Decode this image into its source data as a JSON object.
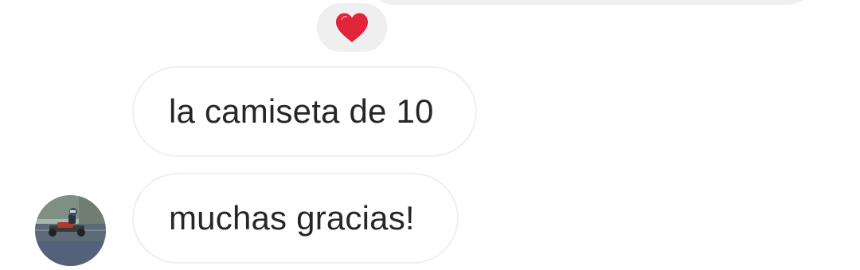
{
  "reaction": {
    "emoji_icon": "red-heart-icon",
    "color": "#e0243a"
  },
  "messages": [
    {
      "text": "la camiseta de 10"
    },
    {
      "text": "muchas gracias!"
    }
  ],
  "avatar": {
    "icon": "go-kart-photo-avatar"
  },
  "colors": {
    "bubble_gray": "#efefef",
    "text": "#262626",
    "background": "#ffffff"
  }
}
